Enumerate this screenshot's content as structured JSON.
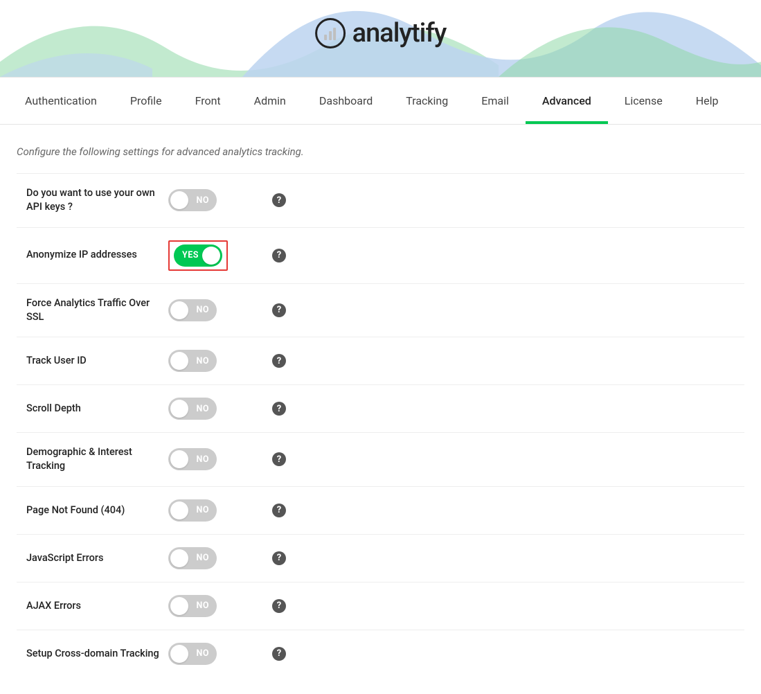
{
  "brand": {
    "name": "analytify"
  },
  "tabs": [
    {
      "id": "authentication",
      "label": "Authentication",
      "active": false
    },
    {
      "id": "profile",
      "label": "Profile",
      "active": false
    },
    {
      "id": "front",
      "label": "Front",
      "active": false
    },
    {
      "id": "admin",
      "label": "Admin",
      "active": false
    },
    {
      "id": "dashboard",
      "label": "Dashboard",
      "active": false
    },
    {
      "id": "tracking",
      "label": "Tracking",
      "active": false
    },
    {
      "id": "email",
      "label": "Email",
      "active": false
    },
    {
      "id": "advanced",
      "label": "Advanced",
      "active": true
    },
    {
      "id": "license",
      "label": "License",
      "active": false
    },
    {
      "id": "help",
      "label": "Help",
      "active": false
    }
  ],
  "intro_text": "Configure the following settings for advanced analytics tracking.",
  "toggle_labels": {
    "on": "YES",
    "off": "NO"
  },
  "help_glyph": "?",
  "settings": [
    {
      "id": "own-api-keys",
      "label": "Do you want to use your own API keys ?",
      "value": false,
      "highlight": false
    },
    {
      "id": "anonymize-ip",
      "label": "Anonymize IP addresses",
      "value": true,
      "highlight": true
    },
    {
      "id": "force-ssl",
      "label": "Force Analytics Traffic Over SSL",
      "value": false,
      "highlight": false
    },
    {
      "id": "track-user-id",
      "label": "Track User ID",
      "value": false,
      "highlight": false
    },
    {
      "id": "scroll-depth",
      "label": "Scroll Depth",
      "value": false,
      "highlight": false
    },
    {
      "id": "demographic",
      "label": "Demographic & Interest Tracking",
      "value": false,
      "highlight": false
    },
    {
      "id": "page-404",
      "label": "Page Not Found (404)",
      "value": false,
      "highlight": false
    },
    {
      "id": "js-errors",
      "label": "JavaScript Errors",
      "value": false,
      "highlight": false
    },
    {
      "id": "ajax-errors",
      "label": "AJAX Errors",
      "value": false,
      "highlight": false
    },
    {
      "id": "cross-domain",
      "label": "Setup Cross-domain Tracking",
      "value": false,
      "highlight": false
    }
  ]
}
